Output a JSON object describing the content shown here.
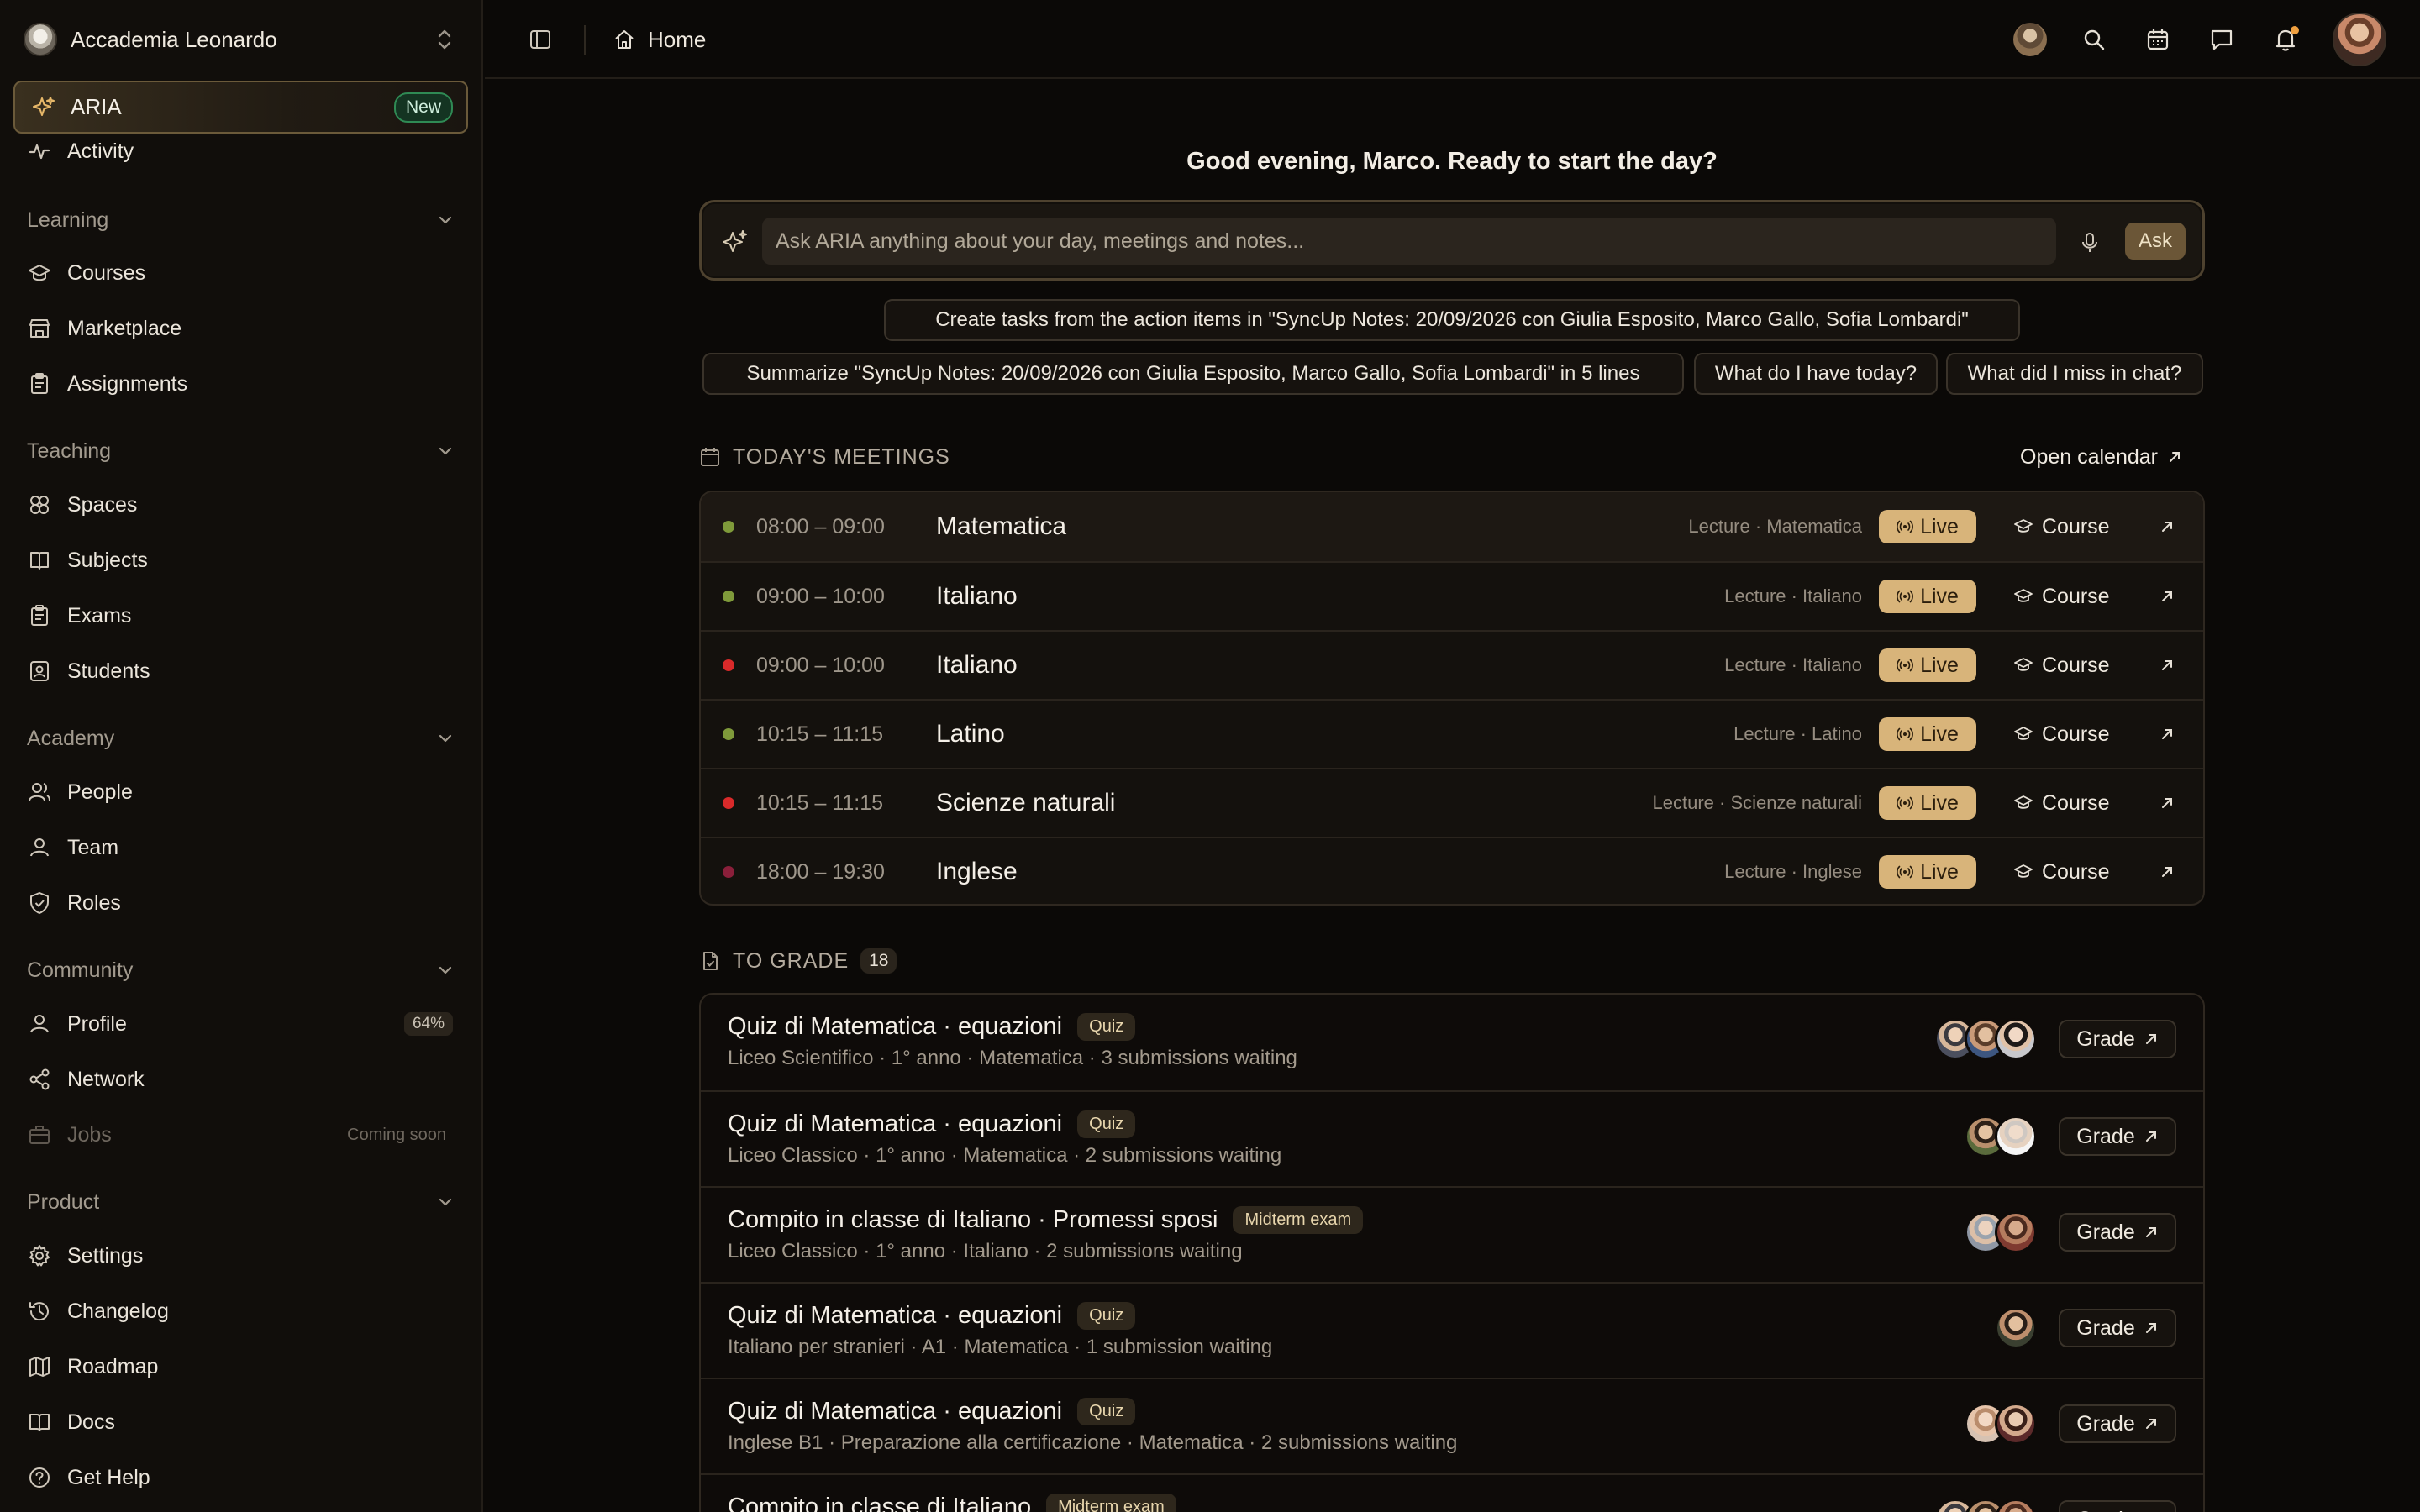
{
  "org": {
    "name": "Accademia Leonardo"
  },
  "sidebar": {
    "aria": {
      "label": "ARIA",
      "badge": "New"
    },
    "activity": "Activity",
    "sections": {
      "learning": "Learning",
      "teaching": "Teaching",
      "academy": "Academy",
      "community": "Community",
      "product": "Product"
    },
    "items": {
      "courses": "Courses",
      "marketplace": "Marketplace",
      "assignments": "Assignments",
      "spaces": "Spaces",
      "subjects": "Subjects",
      "exams": "Exams",
      "students": "Students",
      "people": "People",
      "team": "Team",
      "roles": "Roles",
      "profile": "Profile",
      "profile_pct": "64%",
      "network": "Network",
      "jobs": "Jobs",
      "jobs_status": "Coming soon",
      "settings": "Settings",
      "changelog": "Changelog",
      "roadmap": "Roadmap",
      "docs": "Docs",
      "help": "Get Help"
    }
  },
  "topbar": {
    "breadcrumb": "Home"
  },
  "main": {
    "greeting": "Good evening, Marco. Ready to start the day?",
    "ask": {
      "placeholder": "Ask ARIA anything about your day, meetings and notes...",
      "button": "Ask"
    },
    "suggestions": [
      "Create tasks from the action items in \"SyncUp Notes: 20/09/2026 con Giulia Esposito, Marco Gallo, Sofia Lombardi\"",
      "Summarize \"SyncUp Notes: 20/09/2026 con Giulia Esposito, Marco Gallo, Sofia Lombardi\" in 5 lines",
      "What do I have today?",
      "What did I miss in chat?"
    ],
    "meetings_title": "TODAY'S MEETINGS",
    "open_calendar": "Open calendar",
    "meetings": [
      {
        "time": "08:00 – 09:00",
        "title": "Matematica",
        "meta": "Lecture · Matematica",
        "status": "Live",
        "link": "Course",
        "dot": "#7f9a3a"
      },
      {
        "time": "09:00 – 10:00",
        "title": "Italiano",
        "meta": "Lecture · Italiano",
        "status": "Live",
        "link": "Course",
        "dot": "#7f9a3a"
      },
      {
        "time": "09:00 – 10:00",
        "title": "Italiano",
        "meta": "Lecture · Italiano",
        "status": "Live",
        "link": "Course",
        "dot": "#d92a2a"
      },
      {
        "time": "10:15 – 11:15",
        "title": "Latino",
        "meta": "Lecture · Latino",
        "status": "Live",
        "link": "Course",
        "dot": "#7f9a3a"
      },
      {
        "time": "10:15 – 11:15",
        "title": "Scienze naturali",
        "meta": "Lecture · Scienze naturali",
        "status": "Live",
        "link": "Course",
        "dot": "#d92a2a"
      },
      {
        "time": "18:00 – 19:30",
        "title": "Inglese",
        "meta": "Lecture · Inglese",
        "status": "Live",
        "link": "Course",
        "dot": "#8a1f3a"
      }
    ],
    "grade_title": "TO GRADE",
    "grade_count": "18",
    "grades": [
      {
        "title": "Quiz di Matematica · equazioni",
        "tag": "Quiz",
        "sub": "Liceo Scientifico · 1° anno · Matematica · 3 submissions waiting",
        "button": "Grade"
      },
      {
        "title": "Quiz di Matematica · equazioni",
        "tag": "Quiz",
        "sub": "Liceo Classico · 1° anno · Matematica · 2 submissions waiting",
        "button": "Grade"
      },
      {
        "title": "Compito in classe di Italiano · Promessi sposi",
        "tag": "Midterm exam",
        "sub": "Liceo Classico · 1° anno · Italiano · 2 submissions waiting",
        "button": "Grade"
      },
      {
        "title": "Quiz di Matematica · equazioni",
        "tag": "Quiz",
        "sub": "Italiano per stranieri · A1 · Matematica · 1 submission waiting",
        "button": "Grade"
      },
      {
        "title": "Quiz di Matematica · equazioni",
        "tag": "Quiz",
        "sub": "Inglese B1 · Preparazione alla certificazione · Matematica · 2 submissions waiting",
        "button": "Grade"
      },
      {
        "title": "Compito in classe di Italiano",
        "tag": "Midterm exam",
        "sub": "",
        "button": "Grade"
      }
    ]
  }
}
